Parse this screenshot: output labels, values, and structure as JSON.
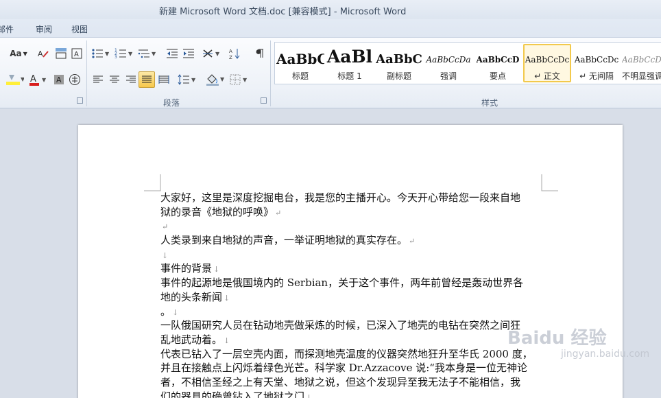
{
  "window": {
    "title": "新建 Microsoft Word 文档.doc [兼容模式]  -  Microsoft Word"
  },
  "tabs": [
    {
      "label": "邮件"
    },
    {
      "label": "审阅"
    },
    {
      "label": "视图"
    }
  ],
  "ribbon": {
    "font_group": {
      "aa_label": "Aa"
    },
    "paragraph_group": {
      "label": "段落"
    },
    "styles_group": {
      "label": "样式",
      "items": [
        {
          "sample": "AaBbC",
          "name": "标题"
        },
        {
          "sample": "AaBl",
          "name": "标题 1"
        },
        {
          "sample": "AaBbC",
          "name": "副标题"
        },
        {
          "sample": "AaBbCcDa",
          "name": "强调"
        },
        {
          "sample": "AaBbCcD",
          "name": "要点"
        },
        {
          "sample": "AaBbCcDc",
          "name": "↵ 正文",
          "selected": true
        },
        {
          "sample": "AaBbCcDc",
          "name": "↵ 无间隔"
        },
        {
          "sample": "AaBbCcDc",
          "name": "不明显强调"
        }
      ]
    }
  },
  "document": {
    "lines": [
      {
        "text": "大家好，这里是深度挖掘电台，我是您的主播开心。今天开心带给您一段来自地"
      },
      {
        "text": "狱的录音《地狱的呼唤》",
        "mark": "↵"
      },
      {
        "text": "",
        "mark": "↵"
      },
      {
        "text": "人类录到来自地狱的声音，一举证明地狱的真实存在。",
        "mark": "↵"
      },
      {
        "text": "",
        "mark": "↓"
      },
      {
        "text": "事件的背景",
        "mark": "↓"
      },
      {
        "text": "事件的起源地是俄国境内的 Serbian，关于这个事件，两年前曾经是轰动世界各"
      },
      {
        "text": "地的头条新闻",
        "mark": "↓"
      },
      {
        "text": "。",
        "mark": "↓"
      },
      {
        "text": "一队俄国研究人员在钻动地壳做采炼的时候，已深入了地壳的电钻在突然之间狂"
      },
      {
        "text": "乱地武动着。",
        "mark": "↓"
      },
      {
        "text": "代表已钻入了一层空壳内面，而探测地壳温度的仪器突然地狂升至华氏 2000 度，"
      },
      {
        "text": "并且在接触点上闪烁着绿色光芒。科学家 Dr.Azzacove 说:“我本身是一位无神论"
      },
      {
        "text": "者，不相信圣经之上有天堂、地狱之说，但这个发现异至我无法子不能相信，我"
      },
      {
        "text": "们的器具的确曾钻入了地狱之门",
        "mark": "↓"
      }
    ]
  },
  "watermark": {
    "brand": "Baidu 经验",
    "url": "jingyan.baidu.com"
  }
}
